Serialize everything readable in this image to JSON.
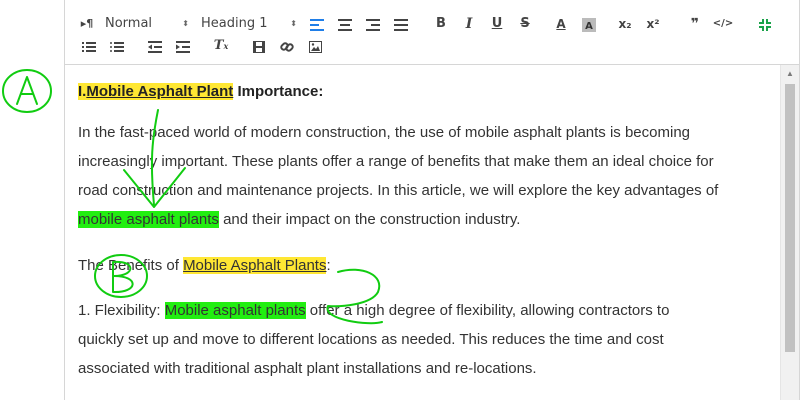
{
  "toolbar": {
    "paragraph_select": "Normal",
    "heading_select": "Heading 1",
    "subscript_label": "x₂",
    "superscript_label": "x²",
    "quote_label": "❞",
    "code_label": "</>",
    "bold_label": "B",
    "italic_label": "I",
    "underline_label": "U",
    "strike_label": "S",
    "font_color_label": "A",
    "accent_color": "#1f7ee8"
  },
  "document": {
    "heading_prefix": "I.",
    "heading_link": "Mobile Asphalt Plant",
    "heading_rest": " Importance:",
    "p1_line1": "In the fast-paced world of modern construction, the use of mobile asphalt plants is becoming",
    "p1_line2": "increasingly important. These plants offer a range of benefits that make them an ideal choice for",
    "p1_line3": "road construction and maintenance projects. In this article, we will explore the key advantages of",
    "p1_highlight": "mobile asphalt plants",
    "p1_tail": " and their impact on the construction industry.",
    "p2_prefix": "The Benefits of ",
    "p2_link": "Mobile Asphalt Plants",
    "p2_suffix": ":",
    "p3_prefix": "1. Flexibility: ",
    "p3_highlight": "Mobile asphalt plants",
    "p3_line1_tail": " offer a high degree of flexibility, allowing contractors to",
    "p3_line2": "quickly set up and move to different locations as needed. This reduces the time and cost",
    "p3_line3": "associated with traditional asphalt plant installations and re-locations."
  },
  "annotations": {
    "mark_a": "A",
    "mark_b": "B",
    "ink_color": "#11cc11",
    "yellow_highlight": "#ffe733",
    "green_highlight": "#22ee11"
  }
}
